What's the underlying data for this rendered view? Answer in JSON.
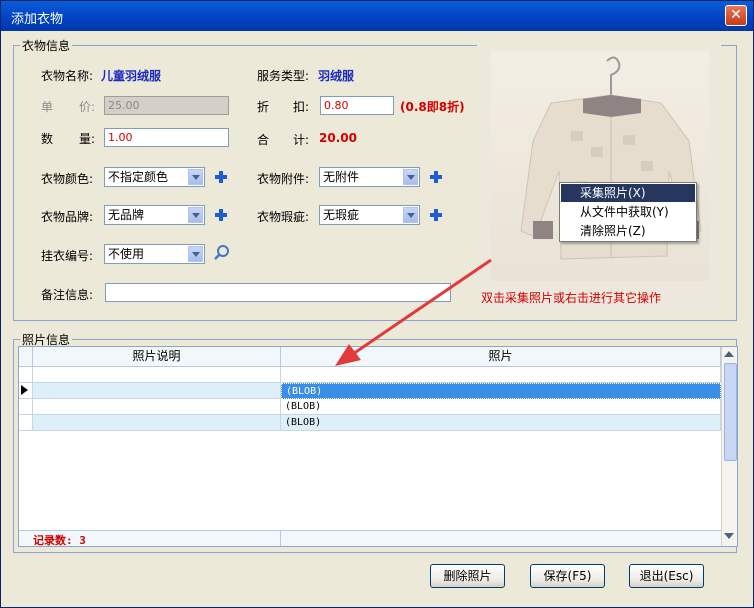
{
  "window": {
    "title": "添加衣物"
  },
  "garment_info": {
    "legend": "衣物信息",
    "name_label": "衣物名称:",
    "name_value": "儿童羽绒服",
    "service_label": "服务类型:",
    "service_value": "羽绒服",
    "price_label_1": "单",
    "price_label_2": "价:",
    "price_value": "25.00",
    "discount_label_1": "折",
    "discount_label_2": "扣:",
    "discount_value": "0.80",
    "discount_hint": "(0.8即8折)",
    "qty_label_1": "数",
    "qty_label_2": "量:",
    "qty_value": "1.00",
    "total_label_1": "合",
    "total_label_2": "计:",
    "total_value": "20.00",
    "color_label": "衣物颜色:",
    "color_value": "不指定颜色",
    "accessory_label": "衣物附件:",
    "accessory_value": "无附件",
    "brand_label": "衣物品牌:",
    "brand_value": "无品牌",
    "defect_label": "衣物瑕疵:",
    "defect_value": "无瑕疵",
    "hanger_label": "挂衣编号:",
    "hanger_value": "不使用",
    "note_label": "备注信息:",
    "note_value": ""
  },
  "photo_area": {
    "hint": "双击采集照片或右击进行其它操作",
    "context_menu": [
      "采集照片(X)",
      "从文件中获取(Y)",
      "清除照片(Z)"
    ]
  },
  "photo_info": {
    "legend": "照片信息",
    "columns": [
      "照片说明",
      "照片"
    ],
    "rows": [
      {
        "desc": "",
        "photo": "(BLOB)",
        "selected": true
      },
      {
        "desc": "",
        "photo": "(BLOB)",
        "selected": false
      },
      {
        "desc": "",
        "photo": "(BLOB)",
        "selected": false
      }
    ],
    "record_count": "记录数: 3"
  },
  "buttons": {
    "delete_photo": "删除照片",
    "save": "保存(F5)",
    "exit": "退出(Esc)"
  },
  "colors": {
    "label_blue": "#1B2BBF",
    "value_red": "#D40000",
    "selection": "#3A8EE6",
    "titlebar": "#0041C2"
  }
}
